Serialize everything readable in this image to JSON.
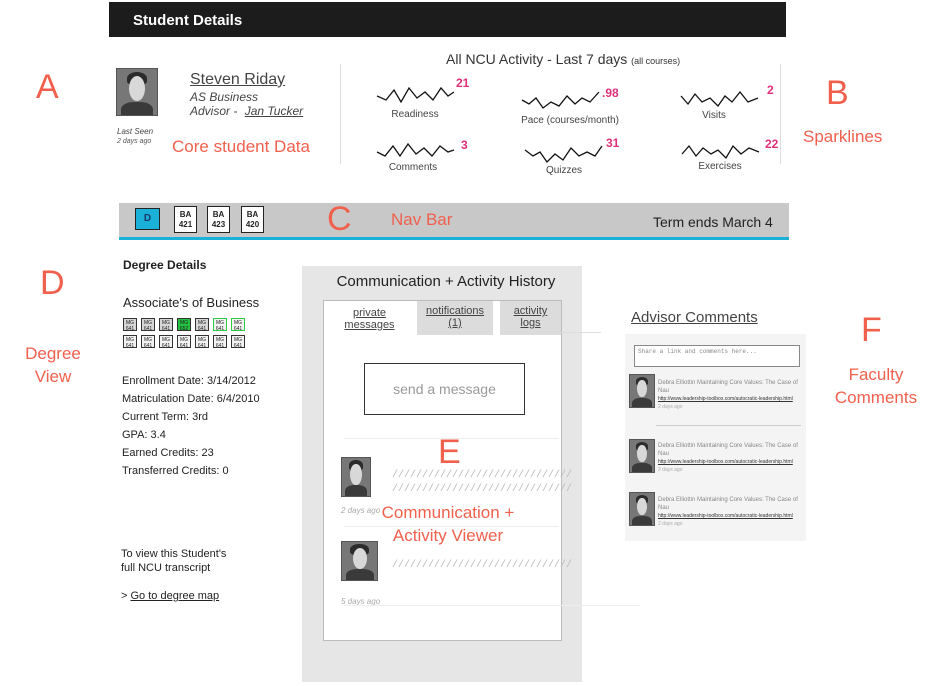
{
  "header": {
    "title": "Student Details"
  },
  "student": {
    "name": "Steven Riday",
    "program": "AS Business",
    "advisor_prefix": "Advisor -",
    "advisor_name": "Jan Tucker",
    "last_seen_label": "Last Seen",
    "last_seen_value": "2 days ago"
  },
  "activity": {
    "title": "All NCU Activity - Last 7 days",
    "title_note": "(all courses)",
    "sparklines": [
      {
        "label": "Readiness",
        "value": "21"
      },
      {
        "label": "Pace (courses/month)",
        "value": ".98"
      },
      {
        "label": "Visits",
        "value": "2"
      },
      {
        "label": "Comments",
        "value": "3"
      },
      {
        "label": "Quizzes",
        "value": "31"
      },
      {
        "label": "Exercises",
        "value": "22"
      }
    ]
  },
  "navbar": {
    "degree_button": "D",
    "courses": [
      {
        "line1": "BA",
        "line2": "421"
      },
      {
        "line1": "BA",
        "line2": "423"
      },
      {
        "line1": "BA",
        "line2": "420"
      }
    ],
    "term_text": "Term ends March 4",
    "accent_color": "#1ab0d8"
  },
  "degree": {
    "heading": "Degree Details",
    "name": "Associate's of Business",
    "progress": [
      [
        "MG 641",
        "MG 641",
        "MG 641",
        "MG 652",
        "MG 641",
        "MG 641",
        "MG 641"
      ],
      [
        "MG 641",
        "MG 641",
        "MG 641",
        "MG 641",
        "MG 641",
        "MG 641",
        "MG 641"
      ]
    ],
    "facts": [
      "Enrollment Date: 3/14/2012",
      "Matriculation Date: 6/4/2010",
      "Current Term: 3rd",
      "GPA: 3.4",
      "Earned Credits: 23",
      "Transferred Credits: 0"
    ],
    "transcript_line1": "To view this Student's",
    "transcript_line2": "full NCU transcript",
    "degree_map_prefix": ">",
    "degree_map_link": "Go to degree map"
  },
  "communication": {
    "title": "Communication + Activity History",
    "tabs": [
      {
        "line1": "private",
        "line2": "messages"
      },
      {
        "line1": "notifications",
        "line2": "(1)"
      },
      {
        "line1": "activity",
        "line2": "logs"
      }
    ],
    "send_placeholder": "send a message",
    "items": [
      {
        "lines": [
          "//////////////////////////////",
          "//////////////////////////////"
        ],
        "time": "2 days ago"
      },
      {
        "lines": [
          "//////////////////////////////"
        ],
        "time": "5 days ago"
      }
    ]
  },
  "advisor_comments": {
    "heading": "Advisor Comments",
    "input_placeholder": "Share a link and comments here...",
    "comments": [
      {
        "author": "Debra Elliottin",
        "title": "Maintaining Core Values: The Case of Nau",
        "url": "http://www.leadership-toolbox.com/autocratic-leadership.html",
        "date": "2 days ago"
      },
      {
        "author": "Debra Elliottin",
        "title": "Maintaining Core Values: The Case of Nau",
        "url": "http://www.leadership-toolbox.com/autocratic-leadership.html",
        "date": "2 days ago"
      },
      {
        "author": "Debra Elliottin",
        "title": "Maintaining Core Values: The Case of Nau",
        "url": "http://www.leadership-toolbox.com/autocratic-leadership.html",
        "date": "2 days ago"
      }
    ]
  },
  "annotations": {
    "A": "A",
    "A_text": "Core student Data",
    "B": "B",
    "B_text": "Sparklines",
    "C": "C",
    "C_text": "Nav Bar",
    "D": "D",
    "D_text1": "Degree",
    "D_text2": "View",
    "E": "E",
    "E_text1": "Communication +",
    "E_text2": "Activity Viewer",
    "F": "F",
    "F_text1": "Faculty",
    "F_text2": "Comments",
    "color": "#f0604d"
  }
}
